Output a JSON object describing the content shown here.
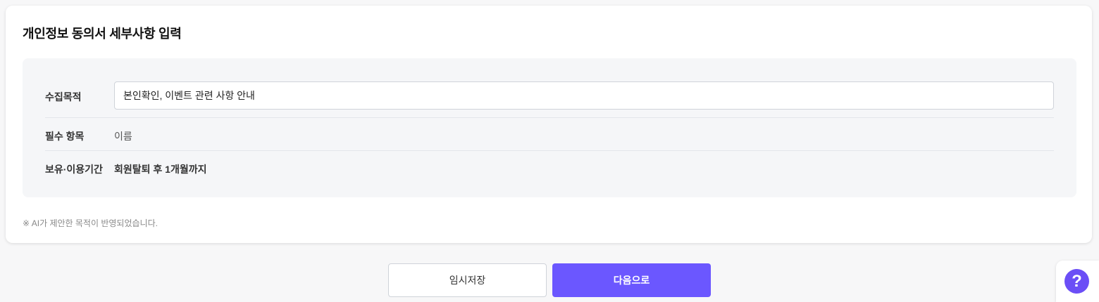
{
  "card": {
    "title": "개인정보 동의서 세부사항 입력"
  },
  "fields": {
    "purpose": {
      "label": "수집목적",
      "value": "본인확인, 이벤트 관련 사항 안내"
    },
    "required": {
      "label": "필수 항목",
      "value": "이름"
    },
    "retention": {
      "label": "보유·이용기간",
      "value": "회원탈퇴 후 1개월까지"
    }
  },
  "note": "※ AI가 제안한 목적이 반영되었습니다.",
  "buttons": {
    "temp_save": "임시저장",
    "next": "다음으로"
  },
  "help": {
    "icon": "question-icon",
    "glyph": "?"
  },
  "colors": {
    "accent": "#6b57ff",
    "help": "#6b4ef6",
    "panel_bg": "#f5f6f8"
  }
}
